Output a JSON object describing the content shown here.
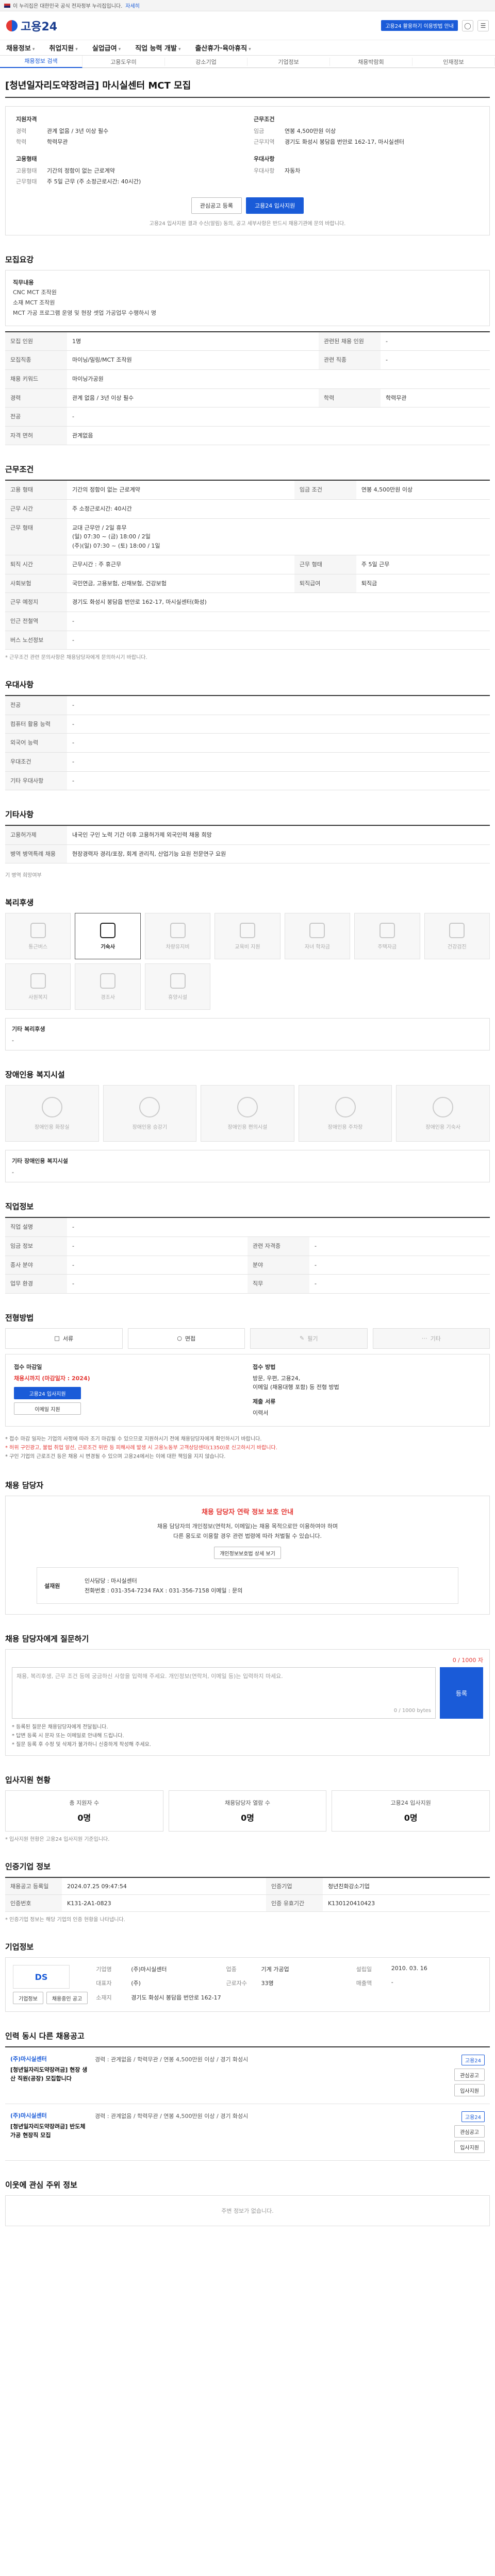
{
  "gov_bar": {
    "text": "이 누리집은 대한민국 공식 전자정부 누리집입니다.",
    "toggle": "자세히"
  },
  "header": {
    "logo": "고용24",
    "notice": "고용24 활용하기 이용방법 안내",
    "login_icon": "person-icon",
    "menu_icon": "menu-icon"
  },
  "gnb": [
    "채용정보",
    "취업지원",
    "실업급여",
    "직업 능력 개발",
    "출산휴가·육아휴직"
  ],
  "subnav": [
    "채용정보 검색",
    "고용도우미",
    "강소기업",
    "기업정보",
    "채용박람회",
    "인재정보"
  ],
  "job": {
    "title": "[청년일자리도약장려금] 마시실센터 MCT 모집",
    "summary": {
      "left_heading": "지원자격",
      "left": [
        {
          "k": "경력",
          "v": "관계 없음 / 3년 이상 필수"
        },
        {
          "k": "학력",
          "v": "학력무관"
        }
      ],
      "left2_heading": "고용형태",
      "left2": [
        {
          "k": "고용형태",
          "v": "기간의 정함이 없는 근로계약"
        },
        {
          "k": "근무형태",
          "v": "주 5일 근무 (주 소정근로시간: 40시간)"
        }
      ],
      "right_heading": "근무조건",
      "right": [
        {
          "k": "임금",
          "v": "연봉 4,500만원 이상"
        },
        {
          "k": "근무지역",
          "v": "경기도 화성시 봉담읍 번안로 162-17, 마시실센터"
        }
      ],
      "right2_heading": "우대사항",
      "right2": [
        {
          "k": "우대사항",
          "v": "자동차"
        }
      ],
      "btn_scrap": "관심공고 등록",
      "btn_apply": "고용24 입사지원",
      "note": "고용24 입사지원 결과 수신(알림) 동의, 공고 세부사항은 반드시 채용기관에 문의 바랍니다."
    }
  },
  "sections": {
    "recruit": "모집요강",
    "conditions": "근무조건",
    "preferred": "우대사항",
    "other": "기타사항",
    "benefits": "복리후생",
    "disability": "장애인용 복지시설",
    "job_info": "직업정보",
    "process": "전형방법",
    "contact": "채용 담당자",
    "qa": "채용 담당자에게 질문하기",
    "applicants": "입사지원 현황",
    "meta": "인증기업 정보",
    "company": "기업정보",
    "related": "인력 동시 다른 채용공고",
    "around": "이웃에 관심 주위 정보"
  },
  "recruit_desc": {
    "head": "직무내용",
    "lines": [
      "CNC MCT 조작원",
      "소재 MCT 조작원",
      "MCT 가공 프로그램 운영 및 현장 셋업 가공업무 수행하시 명"
    ]
  },
  "recruit_table": [
    [
      "모집 인원",
      "1명",
      "관련된 채용 인원",
      "-"
    ],
    [
      "모집직종",
      "마이닝/밀링/MCT 조작원",
      "관련 직종",
      "-"
    ],
    [
      "채용 키워드",
      "마이닝가공원",
      "",
      ""
    ],
    [
      "경력",
      "관계 없음 / 3년 이상 필수",
      "학력",
      "학력무관"
    ],
    [
      "전공",
      "-",
      "",
      ""
    ],
    [
      "자격 면허",
      "관계없음",
      "",
      ""
    ]
  ],
  "conditions_table": [
    [
      "고용 형태",
      "기간의 정함이 없는 근로계약",
      "임금 조건",
      "연봉 4,500만원 이상"
    ],
    [
      "근무 시간",
      "주 소정근로시간: 40시간",
      "",
      ""
    ],
    [
      "근무 형태",
      "교대 근무안 / 2일 휴무\n(일) 07:30 ~ (금) 18:00 / 2일\n(주)(일) 07:30 ~ (토) 18:00 / 1일",
      "",
      ""
    ],
    [
      "퇴직 시간",
      "근무시간 : 주 휴근무",
      "근무 형태",
      "주 5일 근무"
    ],
    [
      "사회보험",
      "국민연금, 고용보험, 산재보험, 건강보험",
      "퇴직급여",
      "퇴직금"
    ],
    [
      "근무 예정지",
      "경기도 화성시 봉담읍 번안로 162-17, 마시실센터(화성)",
      "",
      ""
    ],
    [
      "인근 전철역",
      "-",
      "",
      ""
    ],
    [
      "버스 노선정보",
      "-",
      "",
      ""
    ]
  ],
  "conditions_note": "* 근무조건 관련 문의사항은 채용담당자에게 문의하시기 바랍니다.",
  "preferred_table": [
    [
      "전공",
      "-"
    ],
    [
      "컴퓨터 활용 능력",
      "-"
    ],
    [
      "외국어 능력",
      "-"
    ],
    [
      "우대조건",
      "-"
    ],
    [
      "기타 우대사항",
      "-"
    ]
  ],
  "other_table": [
    [
      "고용허가제",
      "내국인 구인 노력 기간 이후 고용허가제 외국인력 채용 희망"
    ],
    [
      "병역 병역특례 채용",
      "현장경력자 경리/포장, 회계 관리직, 산업기능 요원 전문연구 요원"
    ]
  ],
  "other_link": "기 병역 희망여부",
  "benefits": [
    {
      "label": "통근버스",
      "icon": "bus-icon",
      "on": false
    },
    {
      "label": "기숙사",
      "icon": "dorm-icon",
      "on": true
    },
    {
      "label": "차량유지비",
      "icon": "car-icon",
      "on": false
    },
    {
      "label": "교육비 지원",
      "icon": "book-icon",
      "on": false
    },
    {
      "label": "자녀 학자금",
      "icon": "cap-icon",
      "on": false
    },
    {
      "label": "주택자금",
      "icon": "house-icon",
      "on": false
    },
    {
      "label": "건강검진",
      "icon": "health-icon",
      "on": false
    },
    {
      "label": "사원복지",
      "icon": "gift-icon",
      "on": false
    },
    {
      "label": "경조사",
      "icon": "flower-icon",
      "on": false
    },
    {
      "label": "휴양시설",
      "icon": "palm-icon",
      "on": false
    }
  ],
  "benefits_etc_title": "기타 복리후생",
  "benefits_etc_value": "-",
  "disability": [
    {
      "label": "장애인용 화장실",
      "icon": "toilet-icon"
    },
    {
      "label": "장애인용 승강기",
      "icon": "elevator-icon"
    },
    {
      "label": "장애인용 편의시설",
      "icon": "ramp-icon"
    },
    {
      "label": "장애인용 주차장",
      "icon": "parking-icon"
    },
    {
      "label": "장애인용 기숙사",
      "icon": "bed-icon"
    }
  ],
  "disability_etc_title": "기타 장애인용 복지시설",
  "disability_etc_value": "-",
  "job_info_table": [
    [
      "직업 설명",
      "-",
      "",
      ""
    ],
    [
      "임금 정보",
      "-",
      "관련 자격증",
      "-"
    ],
    [
      "종사 분야",
      "-",
      "분야",
      "-"
    ],
    [
      "업무 환경",
      "-",
      "직무",
      "-"
    ]
  ],
  "process_cards": [
    {
      "label": "서류",
      "icon": "document-icon",
      "off": false
    },
    {
      "label": "면접",
      "icon": "interview-icon",
      "off": false
    },
    {
      "label": "필기",
      "icon": "pen-icon",
      "off": true
    },
    {
      "label": "기타",
      "icon": "etc-icon",
      "off": true
    }
  ],
  "apply": {
    "deadline_label": "접수 마감일",
    "deadline": "채용시까지 (마감일자 : 2024)",
    "method_label": "접수 방법",
    "method": "방문, 우편, 고용24,\n이메일 (채용대행 포함) 등 전형 방법",
    "btn_apply": "고용24 입사지원",
    "btn_other": "이메일 지원",
    "docs_label": "제출 서류",
    "docs": "이력서"
  },
  "apply_notes": [
    "* 접수 마감 일자는 기업의 사정에 따라 조기 마감될 수 있으므로 지원하시기 전에 채용담당자에게 확인하시기 바랍니다.",
    "* 허위 구인광고, 불법 취업 알선, 근로조건 위반 등 피해사례 발생 시 고용노동부 고객상담센터(1350)로 신고하시기 바랍니다.",
    "* 구인 기업의 근로조건 등은 채용 시 변경될 수 있으며 고용24에서는 이에 대한 책임을 지지 않습니다."
  ],
  "caution": {
    "title": "채용 담당자 연락 정보 보호 안내",
    "lines": [
      "채용 담당자의 개인정보(연락처, 이메일)는 채용 목적으로만 이용하여야 하며",
      "다른 용도로 이용할 경우 관련 법령에 따라 처벌될 수 있습니다."
    ],
    "btn": "개인정보보호법 상세 보기",
    "contact_name": "설재원",
    "contact_lines": [
      "인사담당 : 마시실센터",
      "전화번호 : 031-354-7234   FAX : 031-356-7158   이메일 : 문의"
    ]
  },
  "qa": {
    "limit": "0 / 1000 자",
    "placeholder": "채용, 복리후생, 근무 조건 등에 궁금하신 사항을 입력해 주세요. 개인정보(연락처, 이메일 등)는 입력하지 마세요.",
    "counter": "0 / 1000 bytes",
    "submit": "등록",
    "notes": [
      "* 등록된 질문은 채용담당자에게 전달됩니다.",
      "* 답변 등록 시 문자 또는 이메일로 안내해 드립니다.",
      "* 질문 등록 후 수정 및 삭제가 불가하니 신중하게 작성해 주세요."
    ]
  },
  "applicants": [
    {
      "label": "총 지원자 수",
      "value": "0명"
    },
    {
      "label": "채용담당자 열람 수",
      "value": "0명"
    },
    {
      "label": "고용24 입사지원",
      "value": "0명"
    }
  ],
  "applicants_note": "* 입사지원 현황은 고용24 입사지원 기준입니다.",
  "meta_table": [
    [
      "채용공고 등록일",
      "2024.07.25 09:47:54",
      "인증기업",
      "청년친화강소기업"
    ],
    [
      "인증번호",
      "K131-2A1-0823",
      "인증 유효기간",
      "K130120410423"
    ]
  ],
  "meta_note": "* 인증기업 정보는 해당 기업의 인증 현황을 나타냅니다.",
  "company": {
    "logo": "DS",
    "info": [
      [
        "기업명",
        "(주)마시실센터",
        "업종",
        "기계 가공업",
        "설립일",
        "2010. 03. 16"
      ],
      [
        "대표자",
        "(주)",
        "근로자수",
        "33명",
        "매출액",
        "-"
      ],
      [
        "소재지",
        "경기도 화성시 봉담읍 번안로 162-17",
        "",
        "",
        "",
        ""
      ]
    ],
    "btn_info": "기업정보",
    "btn_more": "채용중인 공고"
  },
  "related": [
    {
      "company": "(주)마시실센터",
      "title": "[청년일자리도약장려금] 현장 생산 직원(공장) 모집합니다",
      "meta": "경력 : 관계없음 / 학력무관 / 연봉 4,500만원 이상 / 경기 화성시",
      "badge": "고용24",
      "btn1": "관심공고",
      "btn2": "입사지원"
    },
    {
      "company": "(주)마시실센터",
      "title": "[청년일자리도약장려금] 반도체 가공 현장직 모집",
      "meta": "경력 : 관계없음 / 학력무관 / 연봉 4,500만원 이상 / 경기 화성시",
      "badge": "고용24",
      "btn1": "관심공고",
      "btn2": "입사지원"
    }
  ],
  "around_empty": "주변 정보가 없습니다."
}
